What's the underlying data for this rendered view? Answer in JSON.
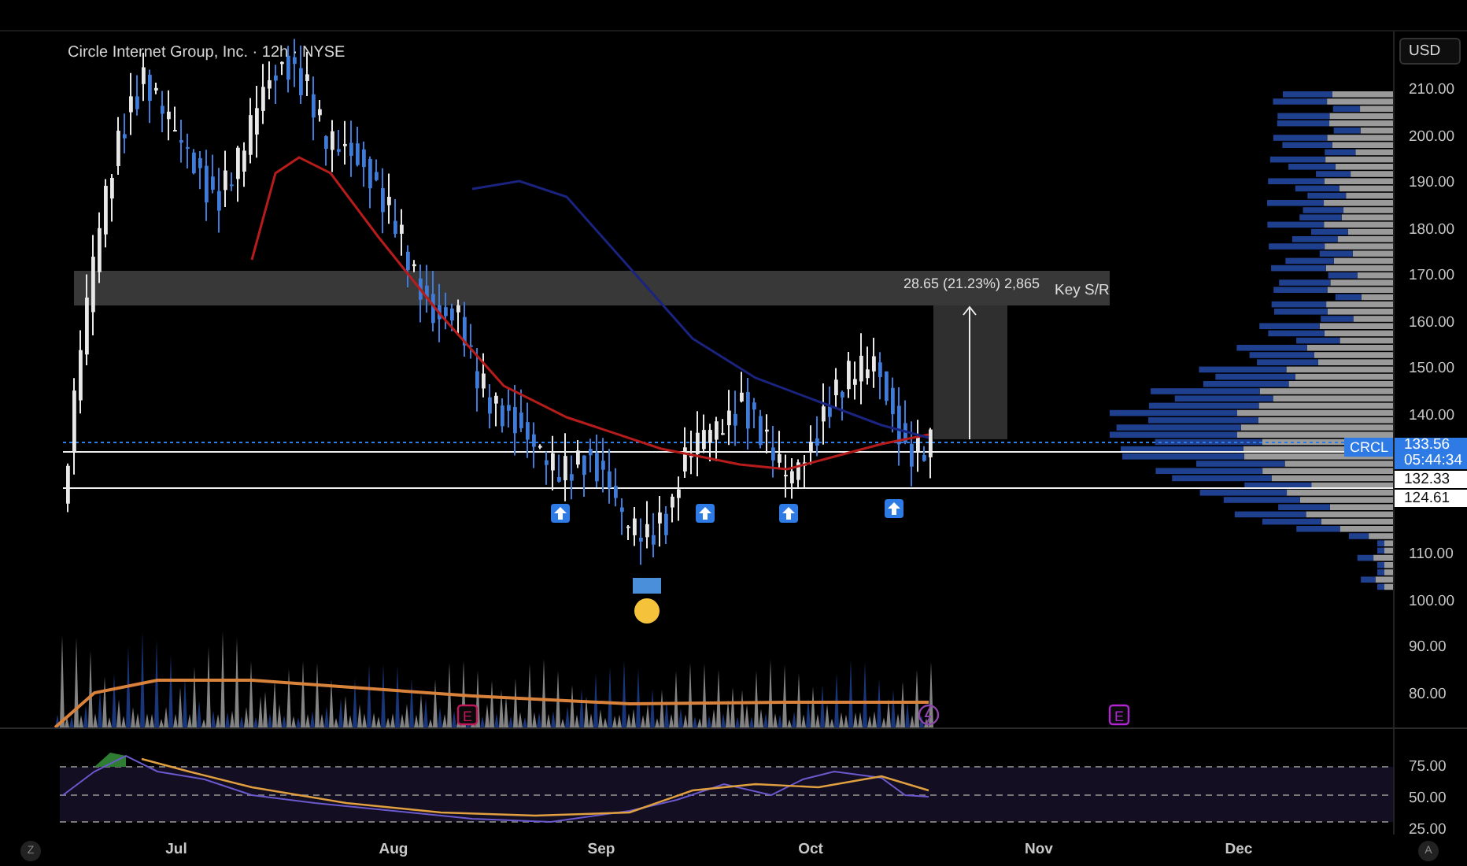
{
  "header": {
    "title": "Circle Internet Group, Inc. · 12h · NYSE",
    "currency_button": "USD"
  },
  "price_axis": {
    "labels": [
      "210.00",
      "200.00",
      "190.00",
      "180.00",
      "170.00",
      "160.00",
      "150.00",
      "140.00",
      "110.00",
      "100.00",
      "90.00",
      "80.00"
    ]
  },
  "price_tags": [
    {
      "kind": "last",
      "symbol": "CRCL",
      "price": "133.56",
      "countdown": "05:44:34"
    },
    {
      "kind": "level",
      "price": "132.33"
    },
    {
      "kind": "level",
      "price": "124.61"
    }
  ],
  "annotations": {
    "measure": "28.65 (21.23%) 2,865",
    "zone_label": "Key S/R"
  },
  "markers": [
    {
      "kind": "earnings",
      "label": "E",
      "color": "#c2185b"
    },
    {
      "kind": "split"
    },
    {
      "kind": "earnings",
      "label": "E",
      "color": "#b026d0"
    }
  ],
  "rsi_axis": {
    "labels": [
      "75.00",
      "50.00",
      "25.00"
    ]
  },
  "time_axis": {
    "labels": [
      "Jul",
      "Aug",
      "Sep",
      "Oct",
      "Nov",
      "Dec"
    ]
  },
  "corner_buttons": [
    {
      "label": "Z"
    },
    {
      "label": "A"
    }
  ]
}
